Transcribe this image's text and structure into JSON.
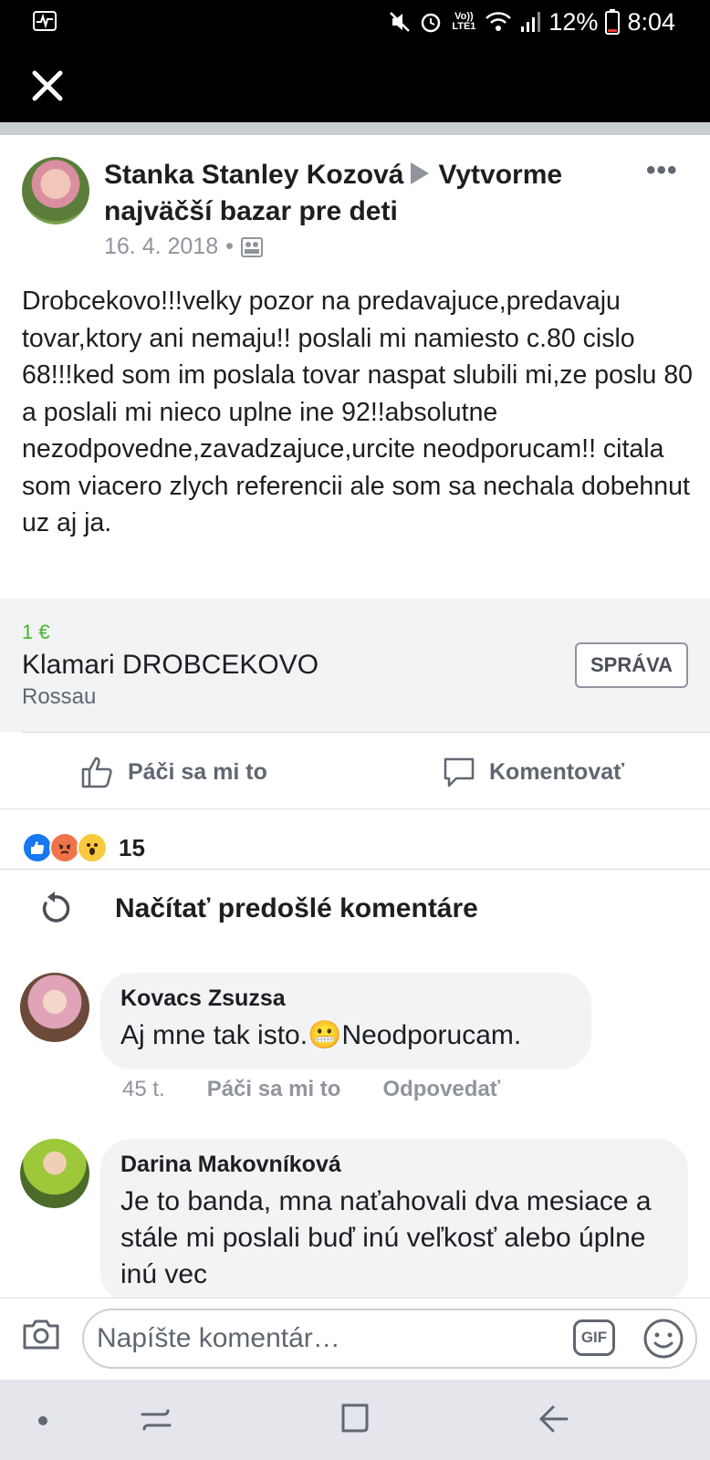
{
  "status": {
    "battery": "12%",
    "time": "8:04",
    "network": "Vo)) LTE1"
  },
  "post": {
    "author": "Stanka Stanley Kozová",
    "group": "Vytvorme najväčší bazar pre deti",
    "date": "16. 4. 2018",
    "date_sep": "•",
    "body": "Drobcekovo!!!velky pozor na predavajuce,predavaju tovar,ktory ani nemaju!! poslali mi namiesto c.80 cislo 68!!!ked som im poslala tovar naspat slubili mi,ze poslu 80 a poslali mi nieco uplne ine 92!!absolutne nezodpovedne,zavadzajuce,urcite neodporucam!! citala som viacero zlych referencii ale som sa nechala dobehnut uz aj ja.",
    "listing": {
      "price": "1 €",
      "title": "Klamari DROBCEKOVO",
      "location": "Rossau",
      "message_button": "SPRÁVA"
    }
  },
  "actions": {
    "like": "Páči sa mi to",
    "comment": "Komentovať"
  },
  "reactions": {
    "count": "15",
    "icons": [
      "like-icon",
      "angry-icon",
      "wow-icon"
    ]
  },
  "load_previous": "Načítať predošlé komentáre",
  "comments": [
    {
      "name": "Kovacs Zsuzsa",
      "text_before": "Aj mne tak isto.",
      "emoji": "😬",
      "text_after": "Neodporucam.",
      "time": "45 t.",
      "like": "Páči sa mi to",
      "reply": "Odpovedať"
    },
    {
      "name": "Darina Makovníková",
      "text": "Je to banda, mna naťahovali dva mesiace a stále mi poslali buď inú veľkosť alebo úplne inú vec"
    }
  ],
  "composer": {
    "placeholder": "Napíšte komentár…",
    "gif": "GIF"
  },
  "colors": {
    "price_green": "#42b72a",
    "like_blue": "#1877f2",
    "angry_orange": "#f0744b",
    "wow_yellow": "#f7c93c"
  }
}
